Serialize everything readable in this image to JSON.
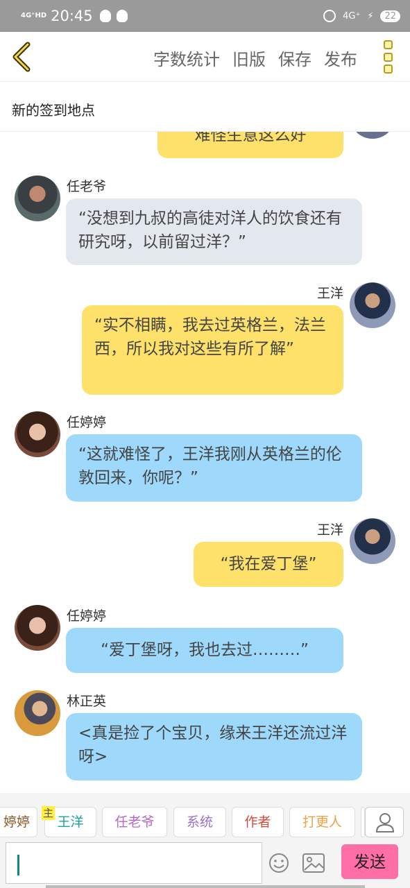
{
  "status": {
    "network": "4G⁺HD",
    "time": "20:45",
    "right_network": "4G⁺",
    "battery": "22"
  },
  "header": {
    "actions": [
      "字数统计",
      "旧版",
      "保存",
      "发布"
    ]
  },
  "subtitle": "新的签到地点",
  "messages": [
    {
      "side": "right",
      "name": "",
      "text": "难怪生意这么好",
      "color": "yellow"
    },
    {
      "side": "left",
      "name": "任老爷",
      "text": "“没想到九叔的高徒对洋人的饮食还有研究呀，以前留过洋？”",
      "color": "gray"
    },
    {
      "side": "right",
      "name": "王洋",
      "text": "“实不相瞒，我去过英格兰，法兰西，所以我对这些有所了解”",
      "color": "yellow"
    },
    {
      "side": "left",
      "name": "任婷婷",
      "text": "“这就难怪了，王洋我刚从英格兰的伦敦回来，你呢？”",
      "color": "blue"
    },
    {
      "side": "right",
      "name": "王洋",
      "text": "“我在爱丁堡”",
      "color": "yellow"
    },
    {
      "side": "left",
      "name": "任婷婷",
      "text": "“爱丁堡呀，我也去过………”",
      "color": "blue"
    },
    {
      "side": "left",
      "name": "林正英",
      "text": "<真是捡了个宝贝，缘来王洋还流过洋呀>",
      "color": "blue"
    }
  ],
  "tabs": {
    "master_tag": "主",
    "items": [
      {
        "label": "婷婷",
        "color": "#8a5a2b"
      },
      {
        "label": "王洋",
        "color": "#1aa3a0"
      },
      {
        "label": "任老爷",
        "color": "#b768c9"
      },
      {
        "label": "系统",
        "color": "#9c6fc9"
      },
      {
        "label": "作者",
        "color": "#d64a3b"
      },
      {
        "label": "打更人",
        "color": "#f0a040"
      }
    ]
  },
  "input": {
    "value": "",
    "send_label": "发送"
  },
  "colors": {
    "yellow_bubble": "#fde16b",
    "gray_bubble": "#e3e8ef",
    "blue_bubble": "#9ed8fb",
    "send_button": "#ff6ea6"
  }
}
